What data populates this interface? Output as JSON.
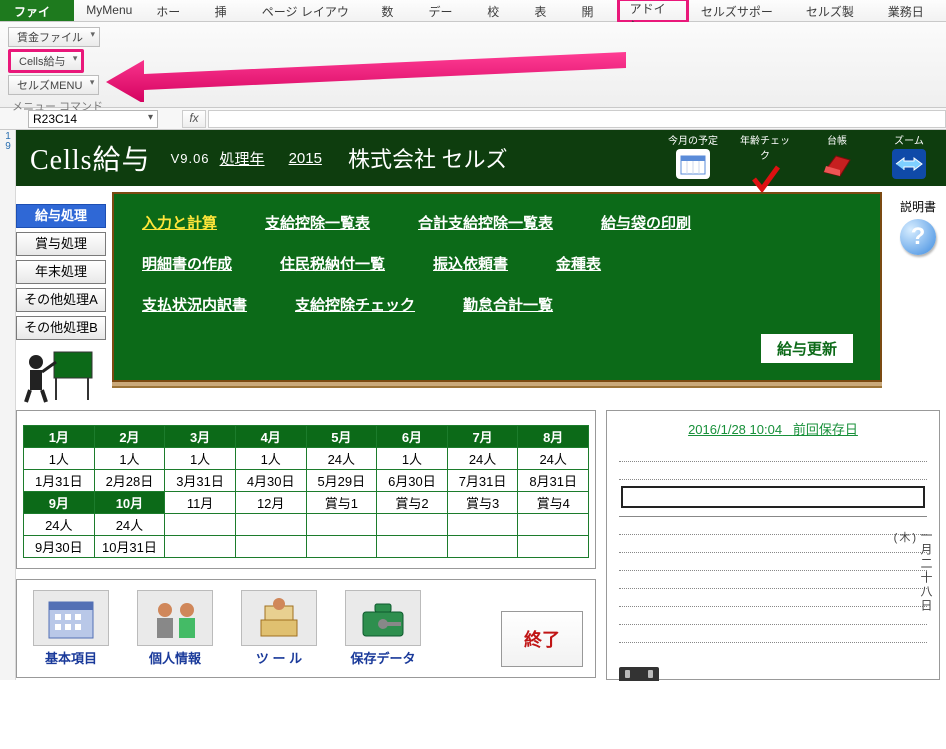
{
  "ribbon": {
    "tabs": [
      "ファイル",
      "MyMenu",
      "ホーム",
      "挿入",
      "ページ レイアウト",
      "数式",
      "データ",
      "校閲",
      "表示",
      "開発",
      "アドイン",
      "セルズサポート",
      "セルズ製品",
      "業務日誌"
    ]
  },
  "subribbon": {
    "items": [
      "賃金ファイル",
      "Cells給与",
      "セルズMENU"
    ],
    "group_label": "メニュー コマンド"
  },
  "formula": {
    "namebox": "R23C14",
    "fx": "fx",
    "value": ""
  },
  "row_numbers": [
    "1",
    "9"
  ],
  "banner": {
    "title": "Cells給与",
    "version": "V9.06",
    "year_label": "処理年",
    "year": "2015",
    "company": "株式会社 セルズ",
    "icons": {
      "schedule": "今月の予定",
      "agecheck": "年齢チェック",
      "ledger": "台帳",
      "zoom": "ズーム"
    }
  },
  "side": {
    "b1": "給与処理",
    "b2": "賞与処理",
    "b3": "年末処理",
    "b4": "その他処理A",
    "b5": "その他処理B"
  },
  "board": {
    "l1": "入力と計算",
    "l2": "支給控除一覧表",
    "l3": "合計支給控除一覧表",
    "l4": "給与袋の印刷",
    "l5": "明細書の作成",
    "l6": "住民税納付一覧",
    "l7": "振込依頼書",
    "l8": "金種表",
    "l9": "支払状況内訳書",
    "l10": "支給控除チェック",
    "l11": "勤怠合計一覧",
    "update": "給与更新"
  },
  "help": {
    "label": "説明書"
  },
  "calendar": {
    "months_top": [
      "1月",
      "2月",
      "3月",
      "4月",
      "5月",
      "6月",
      "7月",
      "8月"
    ],
    "people_top": [
      "1人",
      "1人",
      "1人",
      "1人",
      "24人",
      "1人",
      "24人",
      "24人"
    ],
    "dates_top": [
      "1月31日",
      "2月28日",
      "3月31日",
      "4月30日",
      "5月29日",
      "6月30日",
      "7月31日",
      "8月31日"
    ],
    "months_bot": [
      "9月",
      "10月",
      "11月",
      "12月",
      "賞与1",
      "賞与2",
      "賞与3",
      "賞与4"
    ],
    "people_bot": [
      "24人",
      "24人",
      "",
      "",
      "",
      "",
      "",
      ""
    ],
    "dates_bot": [
      "9月30日",
      "10月31日",
      "",
      "",
      "",
      "",
      "",
      ""
    ]
  },
  "notes": {
    "title_date": "2016/1/28 10:04",
    "title_label": "前回保存日",
    "vertical_date": "一月二十八日",
    "vertical_day": "(木)"
  },
  "bottom_icons": {
    "i1": "基本項目",
    "i2": "個人情報",
    "i3": "ツ ー ル",
    "i4": "保存データ",
    "exit": "終了"
  }
}
